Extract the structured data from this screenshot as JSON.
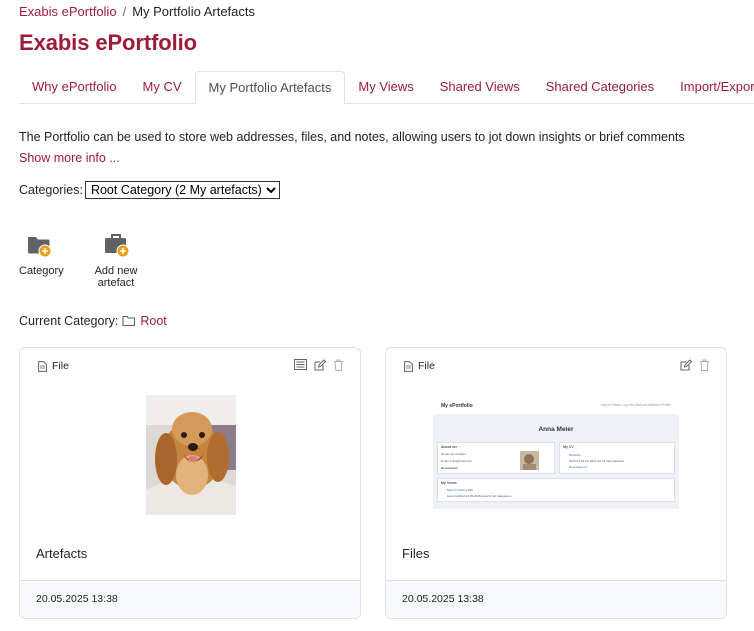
{
  "breadcrumb": {
    "root": "Exabis ePortfolio",
    "separator": "/",
    "current": "My Portfolio Artefacts"
  },
  "page_title": "Exabis ePortfolio",
  "tabs": [
    {
      "label": "Why ePortfolio",
      "active": false
    },
    {
      "label": "My CV",
      "active": false
    },
    {
      "label": "My Portfolio Artefacts",
      "active": true
    },
    {
      "label": "My Views",
      "active": false
    },
    {
      "label": "Shared Views",
      "active": false
    },
    {
      "label": "Shared Categories",
      "active": false
    },
    {
      "label": "Import/Export",
      "active": false
    }
  ],
  "intro": "The Portfolio can be used to store web addresses, files, and notes, allowing users to jot down insights or brief comments",
  "show_more": "Show more info ...",
  "categories": {
    "label": "Categories:",
    "selected": "Root Category (2 My artefacts)"
  },
  "actions": [
    {
      "label": "Category",
      "icon": "folder-add-icon"
    },
    {
      "label": "Add new artefact",
      "icon": "briefcase-add-icon"
    }
  ],
  "current_category": {
    "label": "Current Category:",
    "name": "Root"
  },
  "cards": [
    {
      "type": "File",
      "name": "Artefacts",
      "date": "20.05.2025 13:38",
      "actions": [
        "list-icon",
        "edit-icon",
        "trash-icon"
      ],
      "thumbnail": "dog-photo"
    },
    {
      "type": "File",
      "name": "Files",
      "date": "20.05.2025 13:38",
      "actions": [
        "edit-icon",
        "trash-icon"
      ],
      "thumbnail": "portfolio-screenshot",
      "preview": {
        "brand": "My ePortfolio",
        "nav": "Import Views   Log Into Mahara   Mahara Profile",
        "person": "Anna Meier",
        "about": "About me",
        "about_rows": [
          "Name: Anna Meier",
          "Email: anna@mail.com",
          "Description:"
        ],
        "cv": "My CV",
        "cv_link": "Beruflich",
        "cv_text": "2020-01-01 bis 2021-12-31 Informatikerin",
        "cv_more": "Download CV",
        "views": "My Views",
        "views_link": "Mein Portfolio 2025",
        "views_text": "Last modified 20.05.2025 Ansicht mit Kategorien"
      }
    }
  ],
  "colors": {
    "accent": "#9e1b3a",
    "icon_gray": "#5f6367",
    "badge": "#f39c12",
    "border": "#dee2e6"
  }
}
